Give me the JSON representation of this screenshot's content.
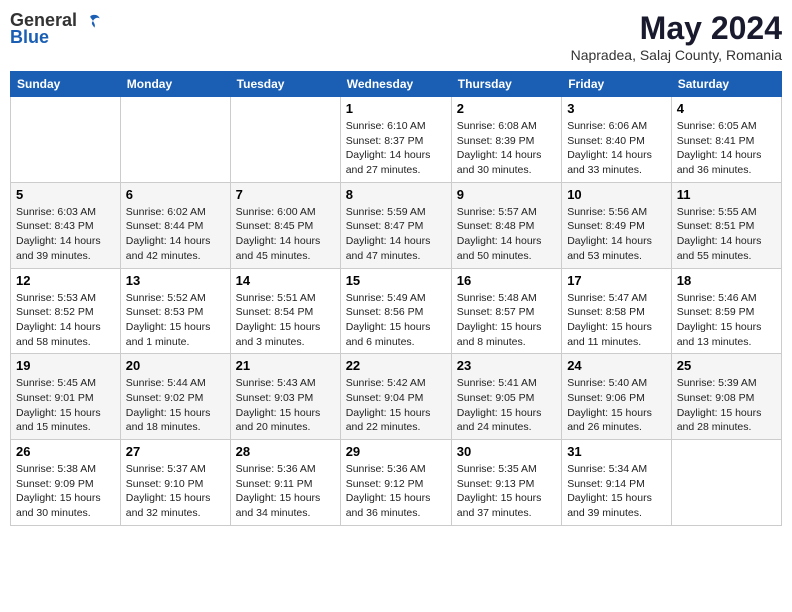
{
  "logo": {
    "general": "General",
    "blue": "Blue"
  },
  "title": "May 2024",
  "location": "Napradea, Salaj County, Romania",
  "headers": [
    "Sunday",
    "Monday",
    "Tuesday",
    "Wednesday",
    "Thursday",
    "Friday",
    "Saturday"
  ],
  "weeks": [
    [
      {
        "day": "",
        "info": ""
      },
      {
        "day": "",
        "info": ""
      },
      {
        "day": "",
        "info": ""
      },
      {
        "day": "1",
        "info": "Sunrise: 6:10 AM\nSunset: 8:37 PM\nDaylight: 14 hours\nand 27 minutes."
      },
      {
        "day": "2",
        "info": "Sunrise: 6:08 AM\nSunset: 8:39 PM\nDaylight: 14 hours\nand 30 minutes."
      },
      {
        "day": "3",
        "info": "Sunrise: 6:06 AM\nSunset: 8:40 PM\nDaylight: 14 hours\nand 33 minutes."
      },
      {
        "day": "4",
        "info": "Sunrise: 6:05 AM\nSunset: 8:41 PM\nDaylight: 14 hours\nand 36 minutes."
      }
    ],
    [
      {
        "day": "5",
        "info": "Sunrise: 6:03 AM\nSunset: 8:43 PM\nDaylight: 14 hours\nand 39 minutes."
      },
      {
        "day": "6",
        "info": "Sunrise: 6:02 AM\nSunset: 8:44 PM\nDaylight: 14 hours\nand 42 minutes."
      },
      {
        "day": "7",
        "info": "Sunrise: 6:00 AM\nSunset: 8:45 PM\nDaylight: 14 hours\nand 45 minutes."
      },
      {
        "day": "8",
        "info": "Sunrise: 5:59 AM\nSunset: 8:47 PM\nDaylight: 14 hours\nand 47 minutes."
      },
      {
        "day": "9",
        "info": "Sunrise: 5:57 AM\nSunset: 8:48 PM\nDaylight: 14 hours\nand 50 minutes."
      },
      {
        "day": "10",
        "info": "Sunrise: 5:56 AM\nSunset: 8:49 PM\nDaylight: 14 hours\nand 53 minutes."
      },
      {
        "day": "11",
        "info": "Sunrise: 5:55 AM\nSunset: 8:51 PM\nDaylight: 14 hours\nand 55 minutes."
      }
    ],
    [
      {
        "day": "12",
        "info": "Sunrise: 5:53 AM\nSunset: 8:52 PM\nDaylight: 14 hours\nand 58 minutes."
      },
      {
        "day": "13",
        "info": "Sunrise: 5:52 AM\nSunset: 8:53 PM\nDaylight: 15 hours\nand 1 minute."
      },
      {
        "day": "14",
        "info": "Sunrise: 5:51 AM\nSunset: 8:54 PM\nDaylight: 15 hours\nand 3 minutes."
      },
      {
        "day": "15",
        "info": "Sunrise: 5:49 AM\nSunset: 8:56 PM\nDaylight: 15 hours\nand 6 minutes."
      },
      {
        "day": "16",
        "info": "Sunrise: 5:48 AM\nSunset: 8:57 PM\nDaylight: 15 hours\nand 8 minutes."
      },
      {
        "day": "17",
        "info": "Sunrise: 5:47 AM\nSunset: 8:58 PM\nDaylight: 15 hours\nand 11 minutes."
      },
      {
        "day": "18",
        "info": "Sunrise: 5:46 AM\nSunset: 8:59 PM\nDaylight: 15 hours\nand 13 minutes."
      }
    ],
    [
      {
        "day": "19",
        "info": "Sunrise: 5:45 AM\nSunset: 9:01 PM\nDaylight: 15 hours\nand 15 minutes."
      },
      {
        "day": "20",
        "info": "Sunrise: 5:44 AM\nSunset: 9:02 PM\nDaylight: 15 hours\nand 18 minutes."
      },
      {
        "day": "21",
        "info": "Sunrise: 5:43 AM\nSunset: 9:03 PM\nDaylight: 15 hours\nand 20 minutes."
      },
      {
        "day": "22",
        "info": "Sunrise: 5:42 AM\nSunset: 9:04 PM\nDaylight: 15 hours\nand 22 minutes."
      },
      {
        "day": "23",
        "info": "Sunrise: 5:41 AM\nSunset: 9:05 PM\nDaylight: 15 hours\nand 24 minutes."
      },
      {
        "day": "24",
        "info": "Sunrise: 5:40 AM\nSunset: 9:06 PM\nDaylight: 15 hours\nand 26 minutes."
      },
      {
        "day": "25",
        "info": "Sunrise: 5:39 AM\nSunset: 9:08 PM\nDaylight: 15 hours\nand 28 minutes."
      }
    ],
    [
      {
        "day": "26",
        "info": "Sunrise: 5:38 AM\nSunset: 9:09 PM\nDaylight: 15 hours\nand 30 minutes."
      },
      {
        "day": "27",
        "info": "Sunrise: 5:37 AM\nSunset: 9:10 PM\nDaylight: 15 hours\nand 32 minutes."
      },
      {
        "day": "28",
        "info": "Sunrise: 5:36 AM\nSunset: 9:11 PM\nDaylight: 15 hours\nand 34 minutes."
      },
      {
        "day": "29",
        "info": "Sunrise: 5:36 AM\nSunset: 9:12 PM\nDaylight: 15 hours\nand 36 minutes."
      },
      {
        "day": "30",
        "info": "Sunrise: 5:35 AM\nSunset: 9:13 PM\nDaylight: 15 hours\nand 37 minutes."
      },
      {
        "day": "31",
        "info": "Sunrise: 5:34 AM\nSunset: 9:14 PM\nDaylight: 15 hours\nand 39 minutes."
      },
      {
        "day": "",
        "info": ""
      }
    ]
  ]
}
